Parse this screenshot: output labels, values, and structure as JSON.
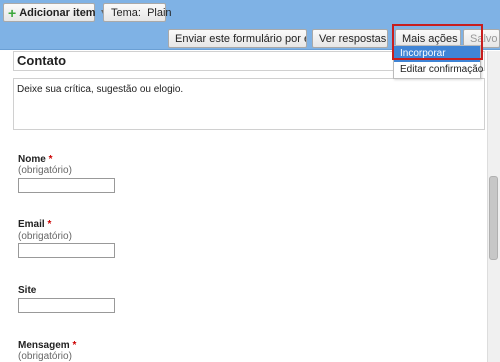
{
  "topbar": {
    "add_item_label": "Adicionar item",
    "theme_label": "Tema:  Plain"
  },
  "toolbar": {
    "send_email_label": "Enviar este formulário por email",
    "view_responses_label": "Ver respostas",
    "more_actions_label": "Mais ações",
    "saved_label": "Salvo"
  },
  "dropdown": {
    "items": [
      "Incorporar",
      "Editar confirmação"
    ],
    "selected": "Incorporar"
  },
  "form": {
    "title": "Contato",
    "description": "Deixe sua crítica, sugestão ou elogio.",
    "required_marker": "*",
    "questions": [
      {
        "label": "Nome",
        "help": "(obrigatório)"
      },
      {
        "label": "Email",
        "help": "(obrigatório)"
      },
      {
        "label": "Site"
      },
      {
        "label": "Mensagem",
        "help": "(obrigatório)"
      }
    ]
  },
  "colors": {
    "toolbar_bg": "#7fb2e5",
    "highlight": "#c81e1e",
    "dropdown_selected": "#3f84d5",
    "required": "#cc0000",
    "add_icon": "#3aa63a"
  }
}
